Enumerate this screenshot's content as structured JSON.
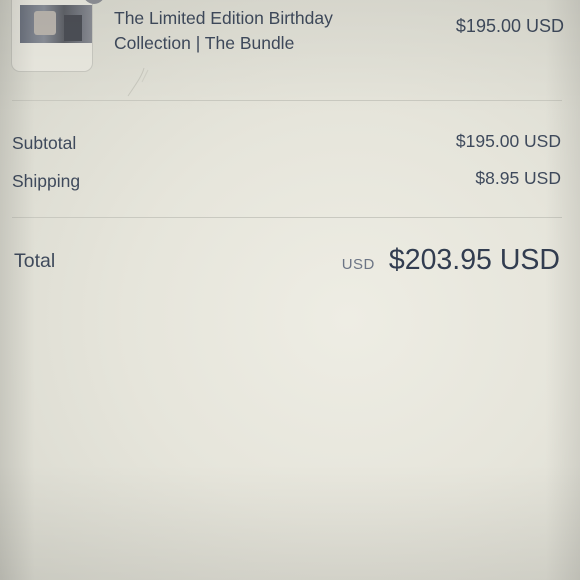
{
  "product": {
    "name_line1": "The Limited Edition Birthday",
    "name_line2": "Collection | The Bundle",
    "price": "$195.00 USD",
    "thumbnail_icon": "product-thumbnail"
  },
  "summary": {
    "subtotal_label": "Subtotal",
    "subtotal_value": "$195.00 USD",
    "shipping_label": "Shipping",
    "shipping_value": "$8.95 USD"
  },
  "total": {
    "label": "Total",
    "currency": "USD",
    "value": "$203.95 USD"
  },
  "colors": {
    "text": "#3f4a5c",
    "muted": "#6c7585",
    "divider": "#c9c9c0",
    "background": "#e6e5db"
  }
}
